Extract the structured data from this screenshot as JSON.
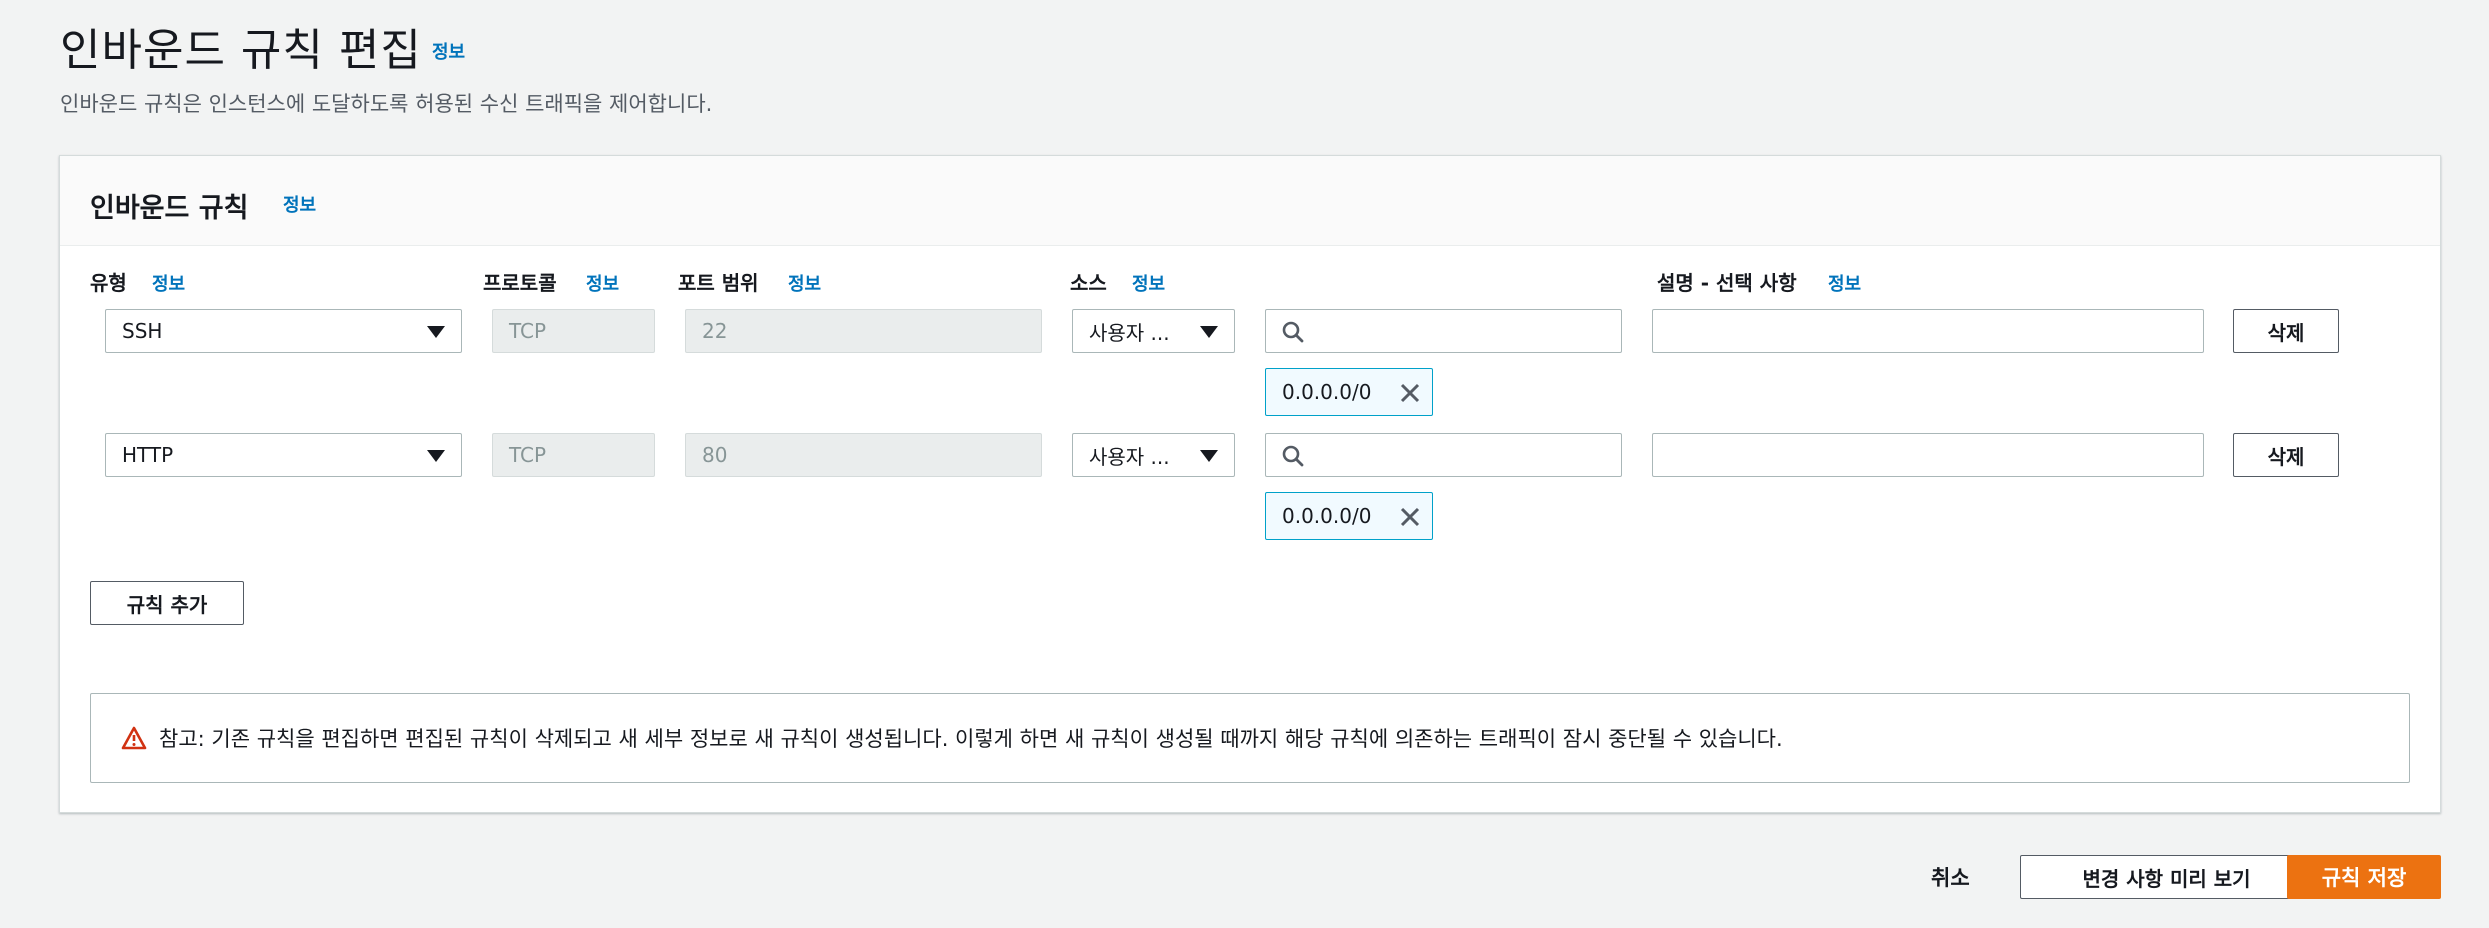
{
  "header": {
    "title": "인바운드 규칙 편집",
    "info": "정보",
    "description": "인바운드 규칙은 인스턴스에 도달하도록 허용된 수신 트래픽을 제어합니다."
  },
  "panel": {
    "title": "인바운드 규칙",
    "info": "정보",
    "columns": {
      "type": "유형",
      "protocol": "프로토콜",
      "port_range": "포트 범위",
      "source": "소스",
      "description": "설명 - 선택 사항",
      "info": "정보"
    },
    "rules": [
      {
        "type": "SSH",
        "protocol": "TCP",
        "port_range": "22",
        "source_type": "사용자 ...",
        "source_search": "",
        "cidr": "0.0.0.0/0",
        "description": "",
        "delete_label": "삭제"
      },
      {
        "type": "HTTP",
        "protocol": "TCP",
        "port_range": "80",
        "source_type": "사용자 ...",
        "source_search": "",
        "cidr": "0.0.0.0/0",
        "description": "",
        "delete_label": "삭제"
      }
    ],
    "add_rule_label": "규칙 추가",
    "warning": "참고: 기존 규칙을 편집하면 편집된 규칙이 삭제되고 새 세부 정보로 새 규칙이 생성됩니다. 이렇게 하면 새 규칙이 생성될 때까지 해당 규칙에 의존하는 트래픽이 잠시 중단될 수 있습니다."
  },
  "footer": {
    "cancel_label": "취소",
    "preview_label": "변경 사항 미리 보기",
    "save_label": "규칙 저장"
  },
  "colors": {
    "link": "#0073bb",
    "primary": "#ec7211",
    "token_border": "#00a1c9",
    "warning": "#d13212"
  }
}
